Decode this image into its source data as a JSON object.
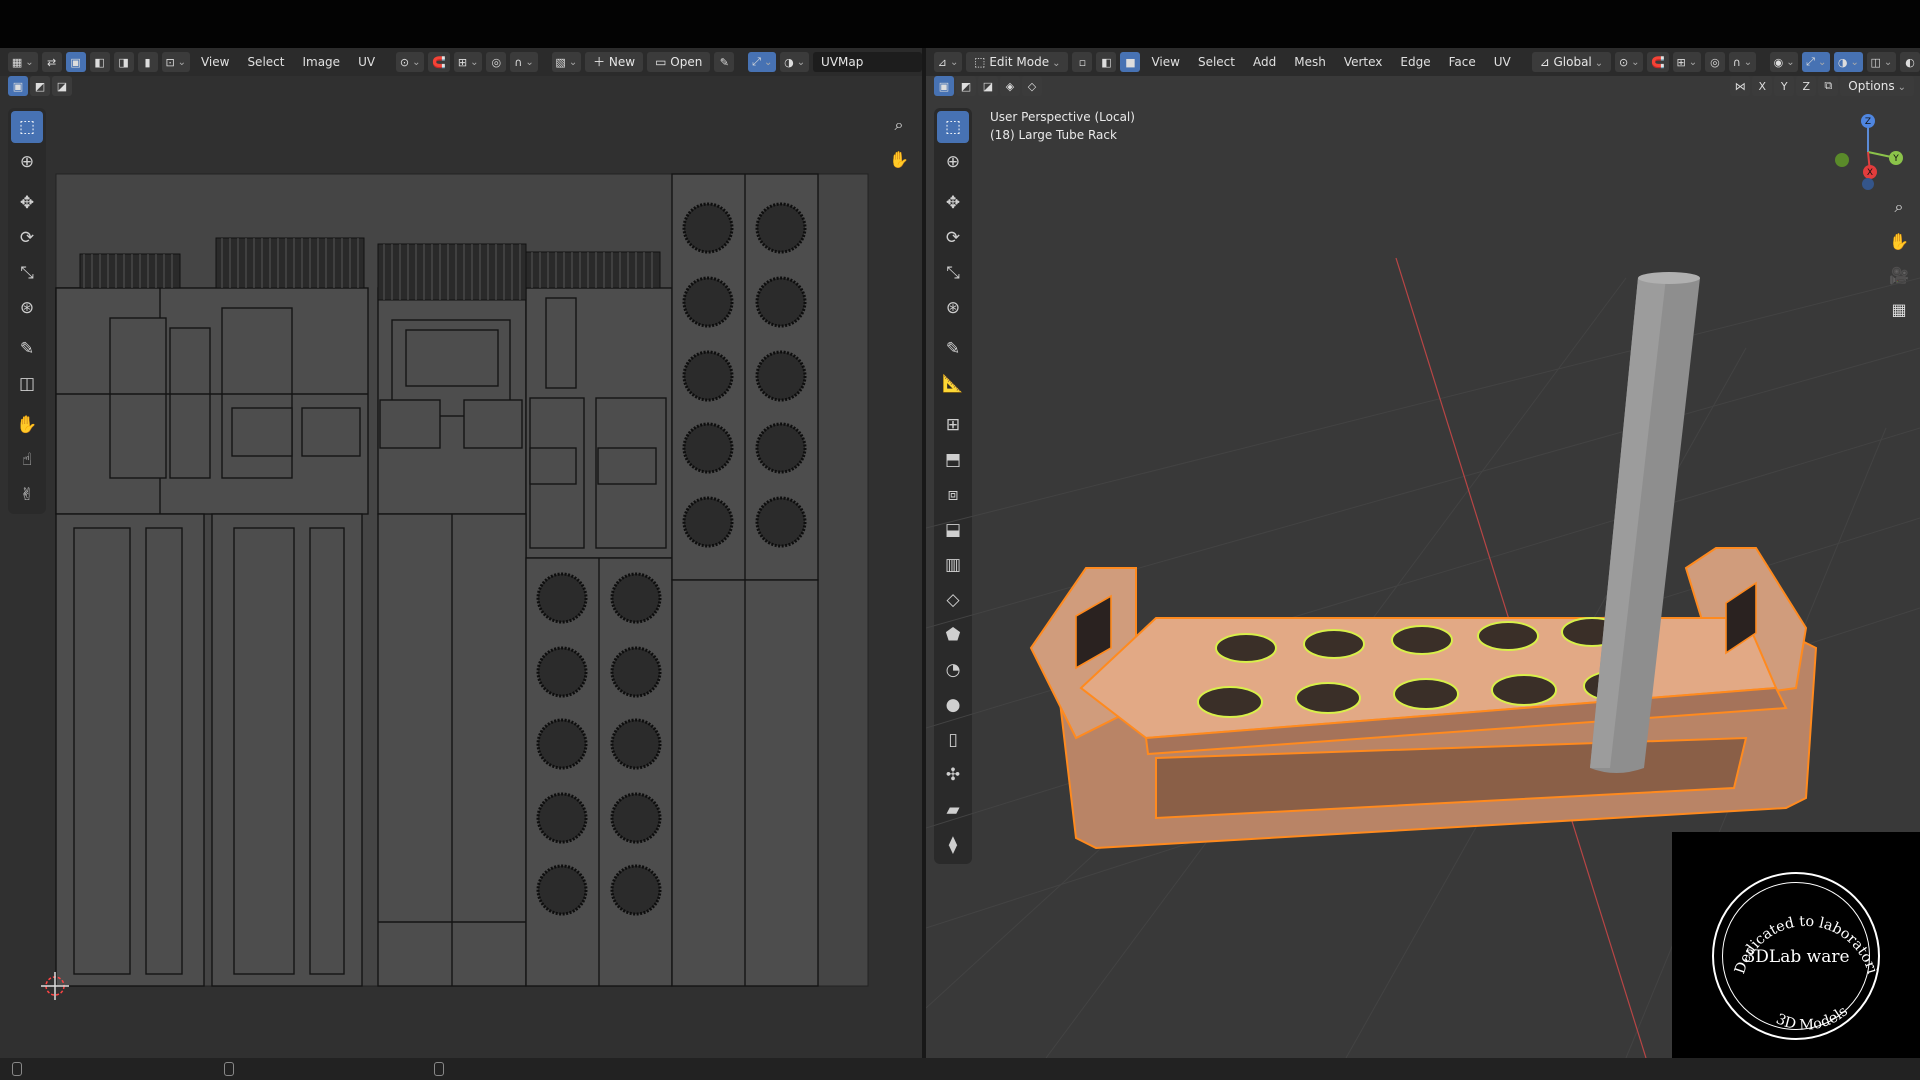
{
  "uv_editor": {
    "header": {
      "menus": [
        "View",
        "Select",
        "Image",
        "UV"
      ],
      "new_label": "New",
      "open_label": "Open",
      "uvmap_name": "UVMap"
    }
  },
  "viewport": {
    "header": {
      "mode": "Edit Mode",
      "menus": [
        "View",
        "Select",
        "Add",
        "Mesh",
        "Vertex",
        "Edge",
        "Face",
        "UV"
      ],
      "transform_orientation": "Global",
      "options_label": "Options",
      "axes": [
        "X",
        "Y",
        "Z"
      ]
    },
    "overlay": {
      "view_name": "User Perspective (Local)",
      "object_name": "(18) Large Tube Rack"
    },
    "gizmo": {
      "x": "X",
      "y": "Y",
      "z": "Z"
    }
  },
  "watermark": {
    "top_text": "Dedicated to laboratories",
    "title": "3DLab ware",
    "bottom_text": "3D Models"
  },
  "colors": {
    "selection_orange": "#ff8a1e",
    "face_select": "#f0a77a",
    "active_blue": "#4772b3",
    "uv_bg": "#4b4b4b",
    "edge_green": "#d8f04a"
  }
}
